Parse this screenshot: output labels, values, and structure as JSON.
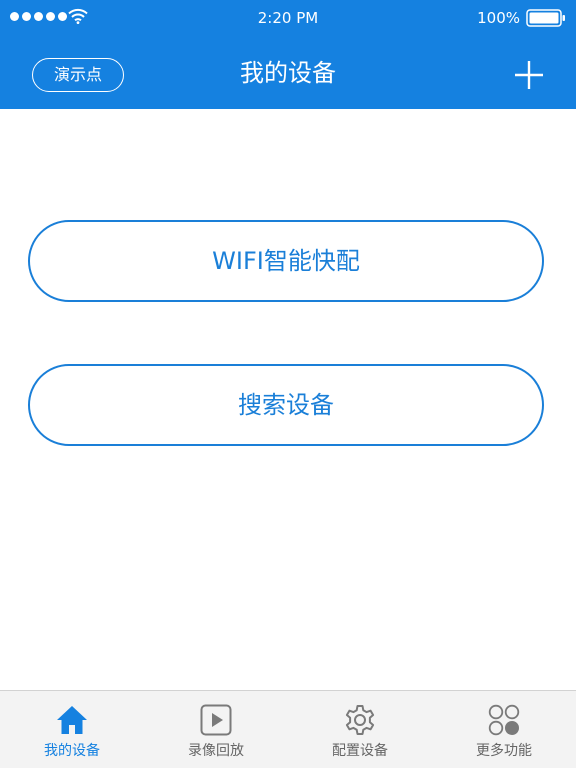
{
  "status_bar": {
    "time": "2:20 PM",
    "battery": "100%",
    "icons": [
      "signal-dots-icon",
      "wifi-icon",
      "battery-icon"
    ]
  },
  "nav": {
    "demo_label": "演示点",
    "title": "我的设备",
    "add_icon": "plus-icon"
  },
  "main": {
    "wifi_config_label": "WIFI智能快配",
    "search_label": "搜索设备"
  },
  "tab_bar": {
    "active_index": 0,
    "tabs": [
      {
        "label": "我的设备",
        "icon": "home-icon"
      },
      {
        "label": "录像回放",
        "icon": "play-icon"
      },
      {
        "label": "配置设备",
        "icon": "gear-icon"
      },
      {
        "label": "更多功能",
        "icon": "more-circles-icon"
      }
    ]
  },
  "colors": {
    "accent": "#1581e0",
    "button_border": "#1a7fd8",
    "tab_bar_bg": "#f3f3f3",
    "tab_inactive": "#666666"
  }
}
